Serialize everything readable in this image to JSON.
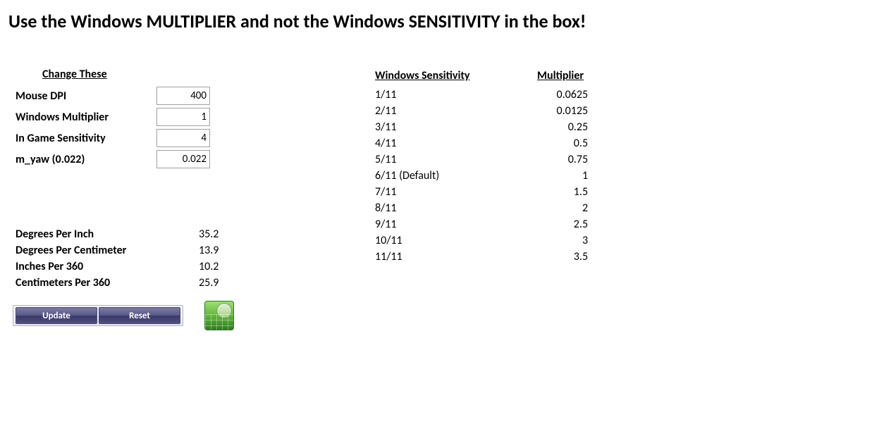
{
  "title": "Use the Windows MULTIPLIER and not the Windows SENSITIVITY in the box!",
  "inputs": {
    "heading": "Change These",
    "rows": [
      {
        "label": "Mouse DPI",
        "value": "400"
      },
      {
        "label": "Windows Multiplier",
        "value": "1"
      },
      {
        "label": "In Game Sensitivity",
        "value": "4"
      },
      {
        "label": "m_yaw (0.022)",
        "value": "0.022"
      }
    ]
  },
  "results": {
    "rows": [
      {
        "label": "Degrees Per Inch",
        "value": "35.2"
      },
      {
        "label": "Degrees Per Centimeter",
        "value": "13.9"
      },
      {
        "label": "Inches Per 360",
        "value": "10.2"
      },
      {
        "label": "Centimeters Per 360",
        "value": "25.9"
      }
    ]
  },
  "buttons": {
    "update": "Update",
    "reset": "Reset"
  },
  "sensitivity_table": {
    "head_sensitivity": "Windows Sensitivity",
    "head_multiplier": "Multiplier",
    "rows": [
      {
        "sens": "1/11",
        "mult": "0.0625"
      },
      {
        "sens": "2/11",
        "mult": "0.0125"
      },
      {
        "sens": "3/11",
        "mult": "0.25"
      },
      {
        "sens": "4/11",
        "mult": "0.5"
      },
      {
        "sens": "5/11",
        "mult": "0.75"
      },
      {
        "sens": "6/11 (Default)",
        "mult": "1"
      },
      {
        "sens": "7/11",
        "mult": "1.5"
      },
      {
        "sens": "8/11",
        "mult": "2"
      },
      {
        "sens": "9/11",
        "mult": "2.5"
      },
      {
        "sens": "10/11",
        "mult": "3"
      },
      {
        "sens": "11/11",
        "mult": "3.5"
      }
    ]
  }
}
